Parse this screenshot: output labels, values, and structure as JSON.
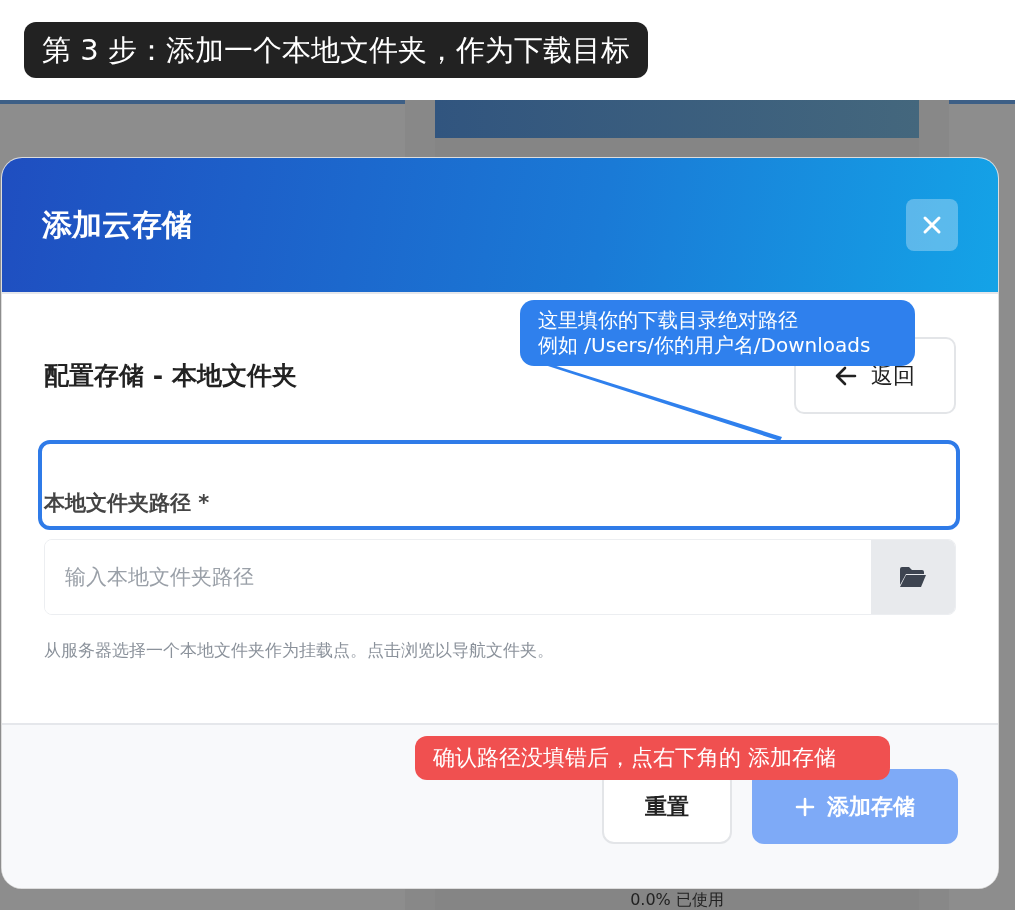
{
  "caption": "第 3 步：添加一个本地文件夹，作为下载目标",
  "background": {
    "usage": "0.0% 已使用"
  },
  "dialog": {
    "title": "添加云存储",
    "section_title": "配置存储 - 本地文件夹",
    "back_button": "返回",
    "field": {
      "label": "本地文件夹路径",
      "required_mark": "*",
      "placeholder": "输入本地文件夹路径"
    },
    "help": "从服务器选择一个本地文件夹作为挂载点。点击浏览以导航文件夹。",
    "buttons": [
      {
        "kind": "secondary",
        "label": "重置",
        "disabled": false
      },
      {
        "kind": "primary",
        "label": "添加存储",
        "disabled": true
      }
    ]
  },
  "annotations": [
    {
      "kind": "highlight",
      "color": "#2f7be8"
    },
    {
      "kind": "callout",
      "color": "#2f80ed",
      "lines": [
        "这里填你的下载目录绝对路径",
        "例如 /Users/你的用户名/Downloads"
      ]
    },
    {
      "kind": "note",
      "color": "#f05050",
      "lines": [
        "确认路径没填错后，点右下角的 添加存储"
      ]
    }
  ]
}
